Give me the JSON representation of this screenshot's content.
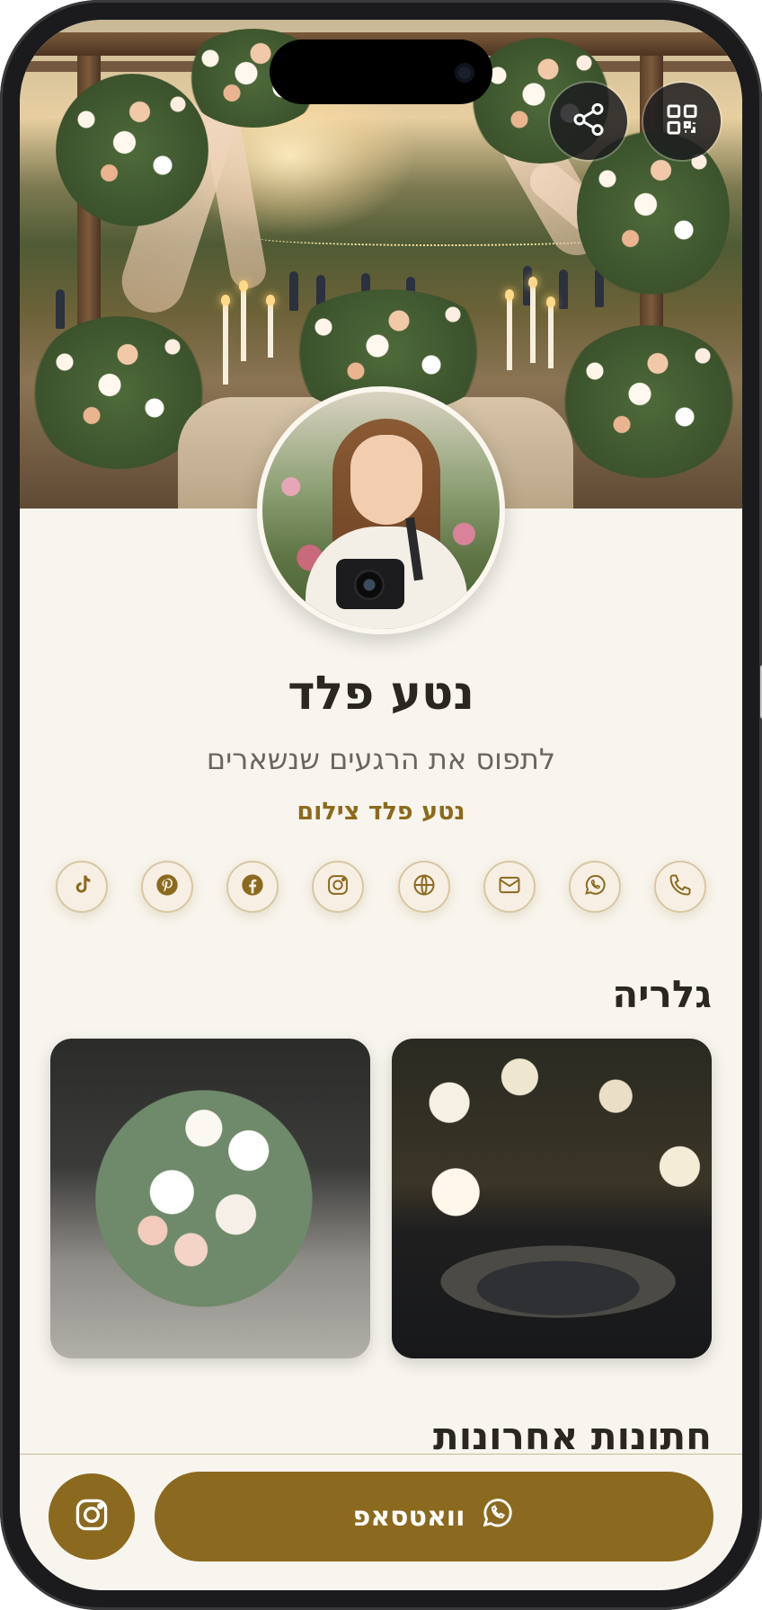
{
  "header": {
    "share_icon": "share-icon",
    "qr_icon": "qr-code-icon"
  },
  "profile": {
    "name": "נטע פלד",
    "tagline": "לתפוס את הרגעים שנשארים",
    "business": "נטע פלד צילום"
  },
  "social": [
    {
      "name": "phone",
      "icon": "phone-icon"
    },
    {
      "name": "whatsapp",
      "icon": "whatsapp-icon"
    },
    {
      "name": "email",
      "icon": "mail-icon"
    },
    {
      "name": "website",
      "icon": "globe-icon"
    },
    {
      "name": "instagram",
      "icon": "instagram-icon"
    },
    {
      "name": "facebook",
      "icon": "facebook-icon"
    },
    {
      "name": "pinterest",
      "icon": "pinterest-icon"
    },
    {
      "name": "tiktok",
      "icon": "tiktok-icon"
    }
  ],
  "gallery": {
    "title": "גלריה"
  },
  "recent_weddings": {
    "title": "חתונות אחרונות"
  },
  "bottom_bar": {
    "whatsapp_label": "וואטסאפ",
    "instagram_icon": "instagram-icon"
  },
  "colors": {
    "accent": "#8b6a20",
    "background": "#f8f5ee",
    "text": "#2a2723"
  }
}
